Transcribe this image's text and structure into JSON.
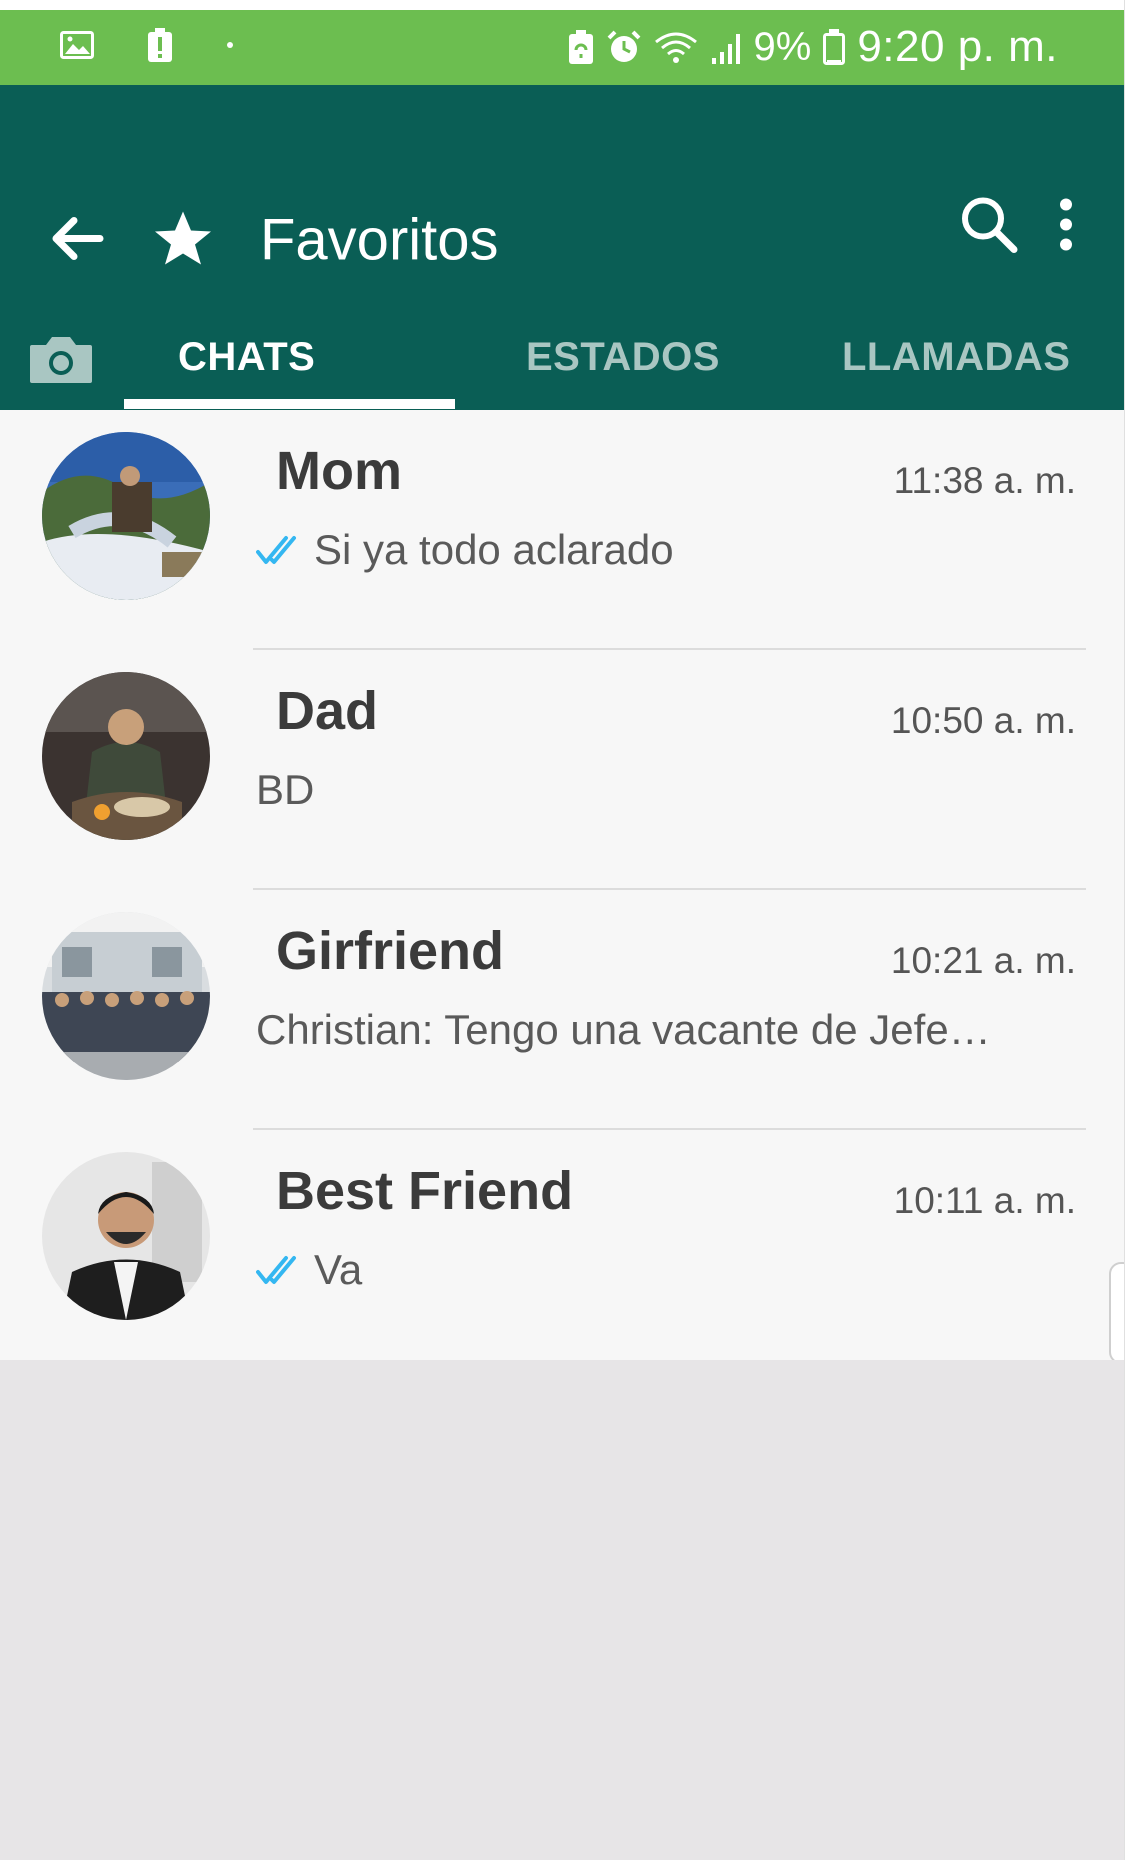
{
  "status_bar": {
    "battery_percent": "9%",
    "time": "9:20 p. m.",
    "icons": [
      "image-icon",
      "battery-alert-icon",
      "dot-icon",
      "battery-saver-icon",
      "alarm-icon",
      "wifi-icon",
      "signal-icon",
      "battery-icon"
    ]
  },
  "header": {
    "title": "Favoritos",
    "icons": [
      "back-arrow-icon",
      "star-icon",
      "search-icon",
      "more-vert-icon"
    ]
  },
  "tabs": [
    {
      "label": "CHATS",
      "active": true
    },
    {
      "label": "ESTADOS",
      "active": false
    },
    {
      "label": "LLAMADAS",
      "active": false
    }
  ],
  "chats": [
    {
      "name": "Mom",
      "time": "11:38 a. m.",
      "preview": "Si ya todo aclarado",
      "read_ticks": true
    },
    {
      "name": "Dad",
      "time": "10:50 a. m.",
      "preview": "BD",
      "read_ticks": false
    },
    {
      "name": "Girfriend",
      "time": "10:21 a. m.",
      "preview": "Christian: Tengo una vacante de Jefe…",
      "read_ticks": false
    },
    {
      "name": "Best Friend",
      "time": "10:11 a. m.",
      "preview": "Va",
      "read_ticks": true
    }
  ],
  "colors": {
    "status_bar": "#6cbe50",
    "app_bar": "#0a5e55",
    "read_ticks": "#34b7f1",
    "inactive_tab": "#a9c6c2"
  }
}
